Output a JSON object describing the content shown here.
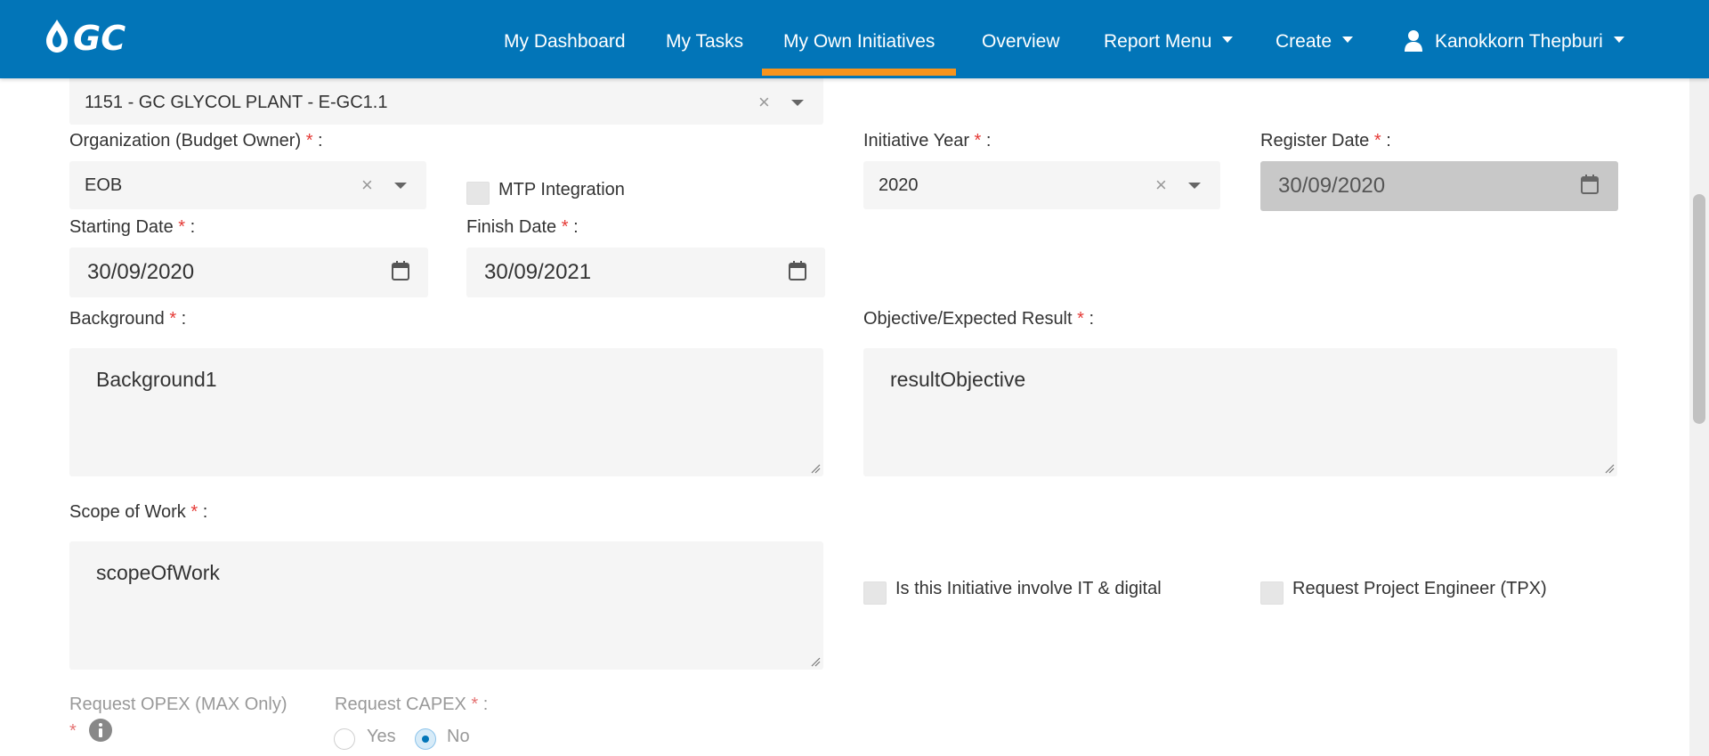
{
  "header": {
    "brand": "GC",
    "nav": [
      {
        "label": "My Dashboard"
      },
      {
        "label": "My Tasks"
      },
      {
        "label": "My Own Initiatives"
      },
      {
        "label": "Overview"
      },
      {
        "label": "Report Menu"
      },
      {
        "label": "Create"
      }
    ],
    "user_name": "Kanokkorn Thepburi",
    "colors": {
      "bar": "#0275b8",
      "active_underline": "#f7941d"
    }
  },
  "form": {
    "plant": {
      "value": "1151 - GC GLYCOL PLANT - E-GC1.1"
    },
    "organization": {
      "label": "Organization (Budget Owner)",
      "value": "EOB"
    },
    "mtp_integration": {
      "label": "MTP Integration",
      "checked": false
    },
    "initiative_year": {
      "label": "Initiative Year",
      "value": "2020"
    },
    "register_date": {
      "label": "Register Date",
      "value": "30/09/2020"
    },
    "starting_date": {
      "label": "Starting Date",
      "value": "30/09/2020"
    },
    "finish_date": {
      "label": "Finish Date",
      "value": "30/09/2021"
    },
    "background": {
      "label": "Background",
      "value": "Background1"
    },
    "objective": {
      "label": "Objective/Expected Result",
      "value": "resultObjective"
    },
    "scope_of_work": {
      "label": "Scope of Work",
      "value": "scopeOfWork"
    },
    "it_digital": {
      "label": "Is this Initiative involve IT & digital",
      "checked": false
    },
    "request_tpx": {
      "label": "Request Project Engineer (TPX)",
      "checked": false
    },
    "request_opex": {
      "label": "Request OPEX (MAX Only)"
    },
    "request_capex": {
      "label": "Request CAPEX",
      "options": [
        "Yes",
        "No"
      ],
      "selected": "No"
    },
    "required_mark": "*",
    "label_suffix": " :"
  }
}
